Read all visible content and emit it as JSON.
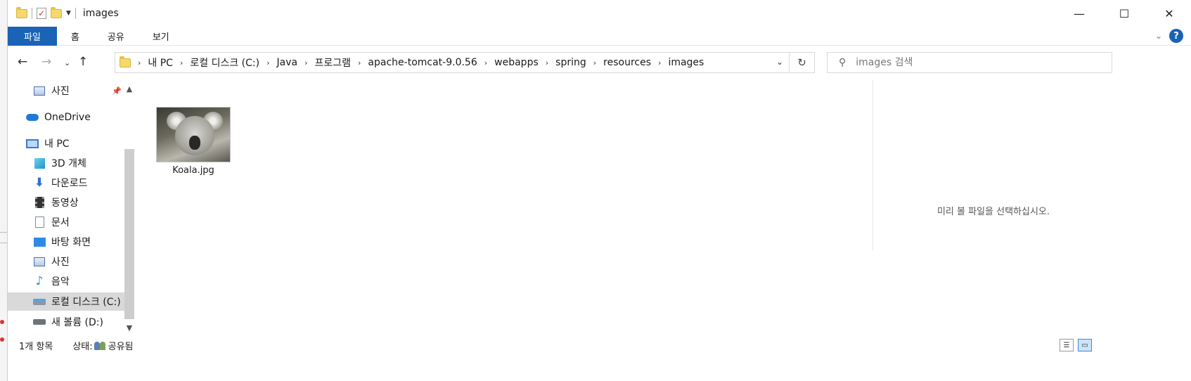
{
  "window": {
    "title": "images",
    "controls": {
      "minimize": "—",
      "maximize": "☐",
      "close": "✕"
    }
  },
  "ribbon": {
    "tabs": [
      "파일",
      "홈",
      "공유",
      "보기"
    ]
  },
  "address": {
    "breadcrumbs": [
      "내 PC",
      "로컬 디스크 (C:)",
      "Java",
      "프로그램",
      "apache-tomcat-9.0.56",
      "webapps",
      "spring",
      "resources",
      "images"
    ]
  },
  "search": {
    "placeholder": "images 검색"
  },
  "sidebar": {
    "items": [
      {
        "label": "사진",
        "icon": "photo-icon",
        "pinned": true
      },
      {
        "label": "OneDrive",
        "icon": "onedrive-icon"
      },
      {
        "label": "내 PC",
        "icon": "pc-icon"
      },
      {
        "label": "3D 개체",
        "icon": "3d-objects-icon"
      },
      {
        "label": "다운로드",
        "icon": "download-icon"
      },
      {
        "label": "동영상",
        "icon": "video-icon"
      },
      {
        "label": "문서",
        "icon": "document-icon"
      },
      {
        "label": "바탕 화면",
        "icon": "desktop-icon"
      },
      {
        "label": "사진",
        "icon": "photo-icon"
      },
      {
        "label": "음악",
        "icon": "music-icon"
      },
      {
        "label": "로컬 디스크 (C:)",
        "icon": "local-disk-icon",
        "selected": true
      },
      {
        "label": "새 볼륨 (D:)",
        "icon": "drive-icon"
      }
    ]
  },
  "files": [
    {
      "name": "Koala.jpg",
      "type": "image"
    }
  ],
  "preview": {
    "message": "미리 볼 파일을 선택하십시오."
  },
  "status": {
    "count": "1개 항목",
    "state_label": "상태:",
    "state_value": "공유됨"
  },
  "colors": {
    "accent": "#1a63b6",
    "selection": "#d9d9d9"
  }
}
